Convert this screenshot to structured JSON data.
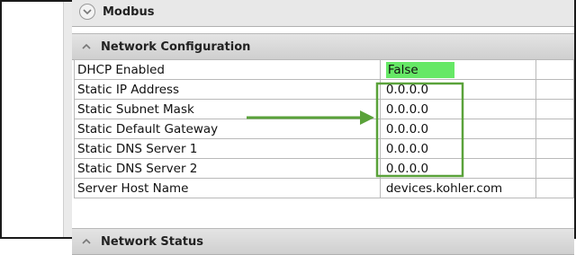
{
  "sections": {
    "modbus": {
      "title": "Modbus",
      "icon": "chevron-down-icon"
    },
    "network_configuration": {
      "title": "Network Configuration",
      "icon": "chevron-up-icon"
    },
    "network_status": {
      "title": "Network Status",
      "icon": "chevron-up-icon"
    }
  },
  "properties": [
    {
      "name": "DHCP Enabled",
      "value": "False"
    },
    {
      "name": "Static IP Address",
      "value": "0.0.0.0"
    },
    {
      "name": "Static Subnet Mask",
      "value": "0.0.0.0"
    },
    {
      "name": "Static Default Gateway",
      "value": "0.0.0.0"
    },
    {
      "name": "Static DNS Server 1",
      "value": "0.0.0.0"
    },
    {
      "name": "Static DNS Server 2",
      "value": "0.0.0.0"
    },
    {
      "name": "Server Host Name",
      "value": "devices.kohler.com"
    }
  ],
  "colors": {
    "highlight": "#66e866",
    "annotation": "#5aa23a"
  }
}
